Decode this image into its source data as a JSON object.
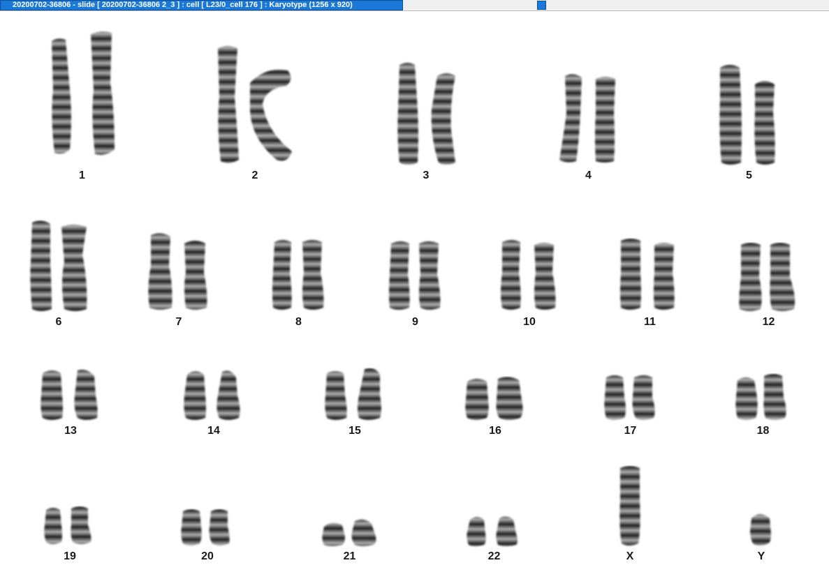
{
  "window": {
    "title": "20200702-36806 - slide [ 20200702-36806 2_3 ] : cell [ L23/0_cell 176 ] : Karyotype  (1256 x 920)"
  },
  "colors": {
    "tab_active": "#1a78d7",
    "chromosome_dark": "#2b2b2b",
    "chromosome_light": "#9a9a9a",
    "background": "#ffffff"
  },
  "karyotype": {
    "labels": {
      "c1": "1",
      "c2": "2",
      "c3": "3",
      "c4": "4",
      "c5": "5",
      "c6": "6",
      "c7": "7",
      "c8": "8",
      "c9": "9",
      "c10": "10",
      "c11": "11",
      "c12": "12",
      "c13": "13",
      "c14": "14",
      "c15": "15",
      "c16": "16",
      "c17": "17",
      "c18": "18",
      "c19": "19",
      "c20": "20",
      "c21": "21",
      "c22": "22",
      "cX": "X",
      "cY": "Y"
    }
  }
}
